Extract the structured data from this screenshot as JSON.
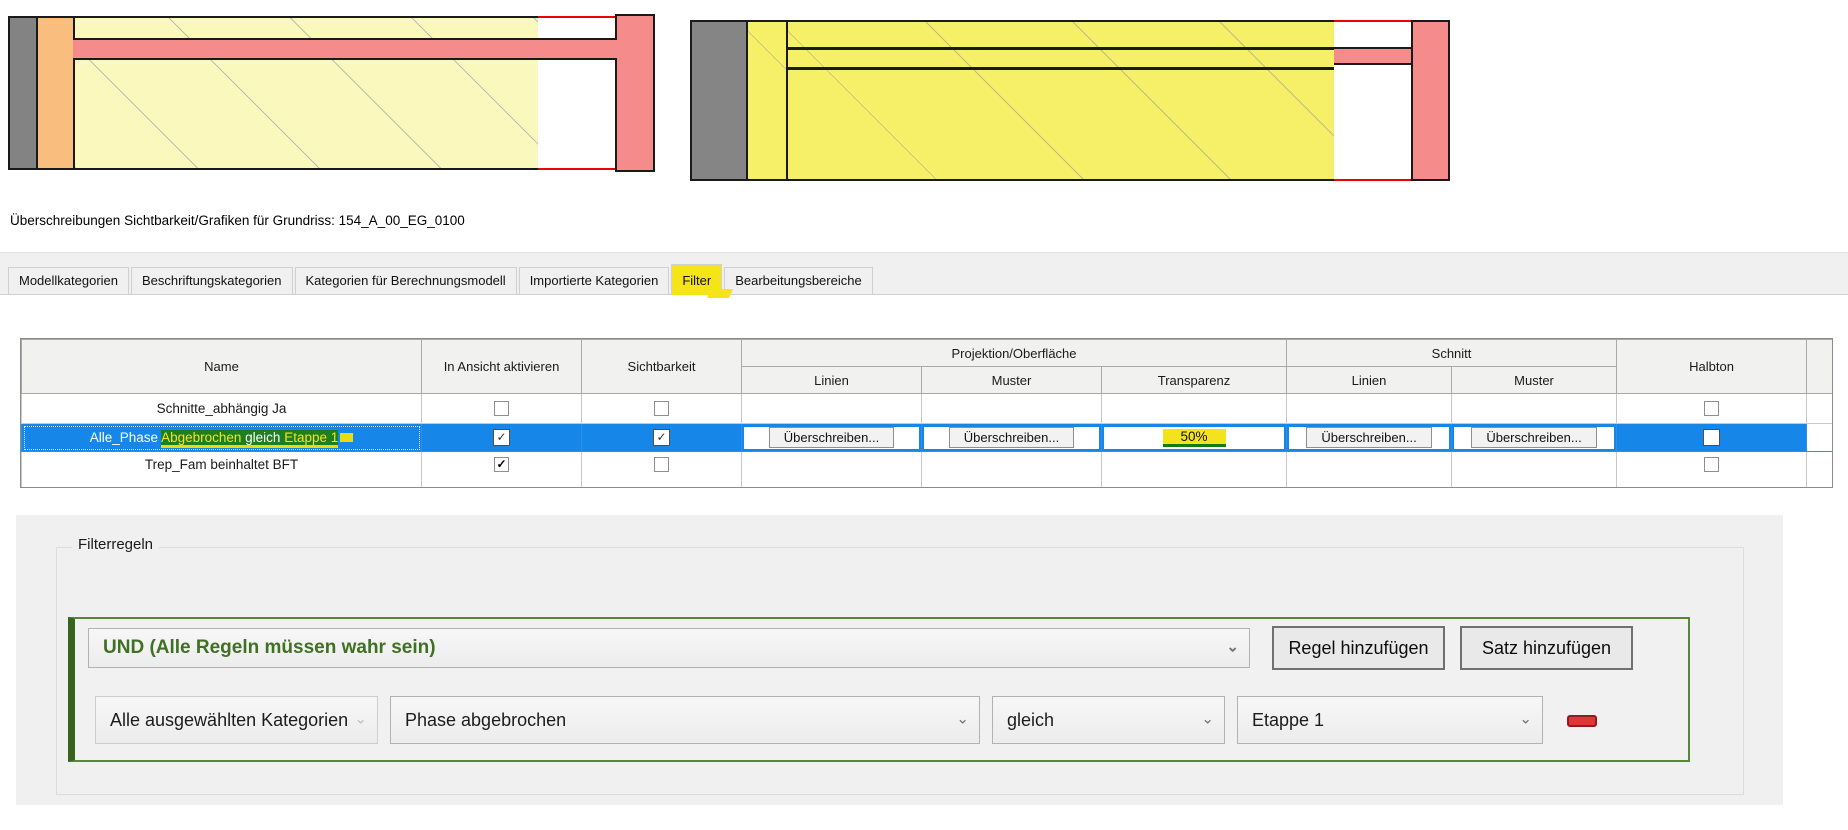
{
  "title": "Überschreibungen Sichtbarkeit/Grafiken für Grundriss: 154_A_00_EG_0100",
  "tabs": {
    "items": [
      "Modellkategorien",
      "Beschriftungskategorien",
      "Kategorien für Berechnungsmodell",
      "Importierte Kategorien",
      "Filter",
      "Bearbeitungsbereiche"
    ],
    "active": "Filter"
  },
  "table": {
    "headers": {
      "name": "Name",
      "in_view": "In Ansicht aktivieren",
      "visibility": "Sichtbarkeit",
      "projection_group": "Projektion/Oberfläche",
      "cut_group": "Schnitt",
      "lines": "Linien",
      "patterns": "Muster",
      "transparency": "Transparenz",
      "halftone": "Halbton"
    },
    "override_button": "Überschreiben...",
    "rows": [
      {
        "name": "Schnitte_abhängig Ja",
        "in_view": false,
        "visibility": false,
        "cut_disabled": true,
        "halftone": false
      },
      {
        "name_parts": {
          "p1": "Alle_Phase ",
          "p2": "Abgebrochen",
          "p3": " gleich ",
          "p4": "Etappe 1"
        },
        "selected": true,
        "in_view": true,
        "visibility": true,
        "transparency": "50%",
        "halftone": false
      },
      {
        "name": "Trep_Fam beinhaltet BFT",
        "in_view": true,
        "visibility": false,
        "halftone": false
      }
    ]
  },
  "filter_rules": {
    "group_label": "Filterregeln",
    "set_operator": "UND (Alle Regeln müssen wahr sein)",
    "add_rule_button": "Regel hinzufügen",
    "add_set_button": "Satz hinzufügen",
    "rule": {
      "category": "Alle ausgewählten Kategorien",
      "parameter": "Phase abgebrochen",
      "operator": "gleich",
      "value": "Etappe 1"
    },
    "chevron": "⌄"
  },
  "colors": {
    "selection_blue": "#1687e8",
    "annotation_yellow": "#f5e417",
    "text_highlight_green": "#1f7e1f",
    "salmon": "#f58b8b",
    "pale_yellow": "#fbf8bd",
    "bright_yellow": "#f6ef68",
    "orange": "#f9be7d",
    "gray_block": "#838383",
    "rule_frame_green": "#598738",
    "transparency_underline_green": "#157a15"
  }
}
